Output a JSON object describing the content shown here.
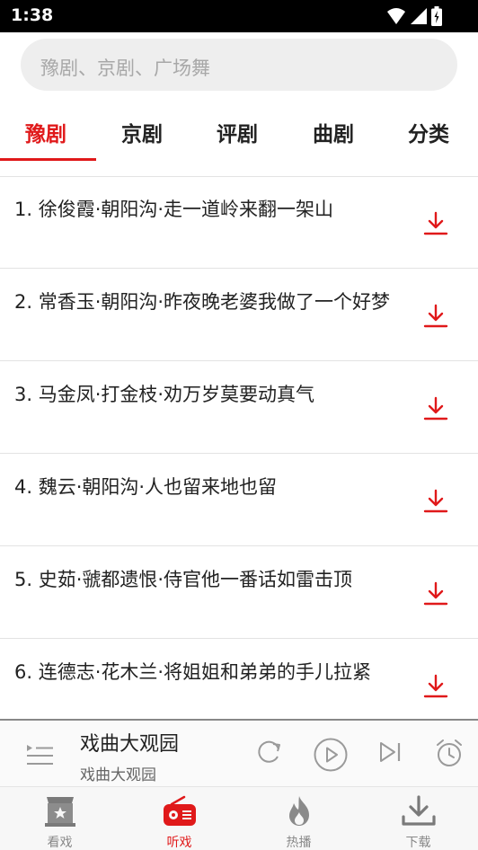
{
  "status_bar": {
    "time": "1:38"
  },
  "search": {
    "placeholder": "豫剧、京剧、广场舞"
  },
  "tabs": [
    {
      "label": "豫剧",
      "active": true
    },
    {
      "label": "京剧",
      "active": false
    },
    {
      "label": "评剧",
      "active": false
    },
    {
      "label": "曲剧",
      "active": false
    },
    {
      "label": "分类",
      "active": false
    }
  ],
  "songs": [
    {
      "title": "1. 徐俊霞·朝阳沟·走一道岭来翻一架山"
    },
    {
      "title": "2. 常香玉·朝阳沟·昨夜晚老婆我做了一个好梦"
    },
    {
      "title": "3. 马金凤·打金枝·劝万岁莫要动真气"
    },
    {
      "title": "4. 魏云·朝阳沟·人也留来地也留"
    },
    {
      "title": "5. 史茹·虢都遗恨·侍官他一番话如雷击顶"
    },
    {
      "title": "6. 连德志·花木兰·将姐姐和弟弟的手儿拉紧"
    }
  ],
  "player": {
    "title": "戏曲大观园",
    "subtitle": "戏曲大观园"
  },
  "bottom_nav": [
    {
      "label": "看戏",
      "icon": "theater-icon",
      "active": false
    },
    {
      "label": "听戏",
      "icon": "radio-icon",
      "active": true
    },
    {
      "label": "热播",
      "icon": "flame-icon",
      "active": false
    },
    {
      "label": "下载",
      "icon": "download-icon",
      "active": false
    }
  ],
  "colors": {
    "accent": "#e0191a",
    "text": "#222222",
    "muted": "#888888"
  }
}
